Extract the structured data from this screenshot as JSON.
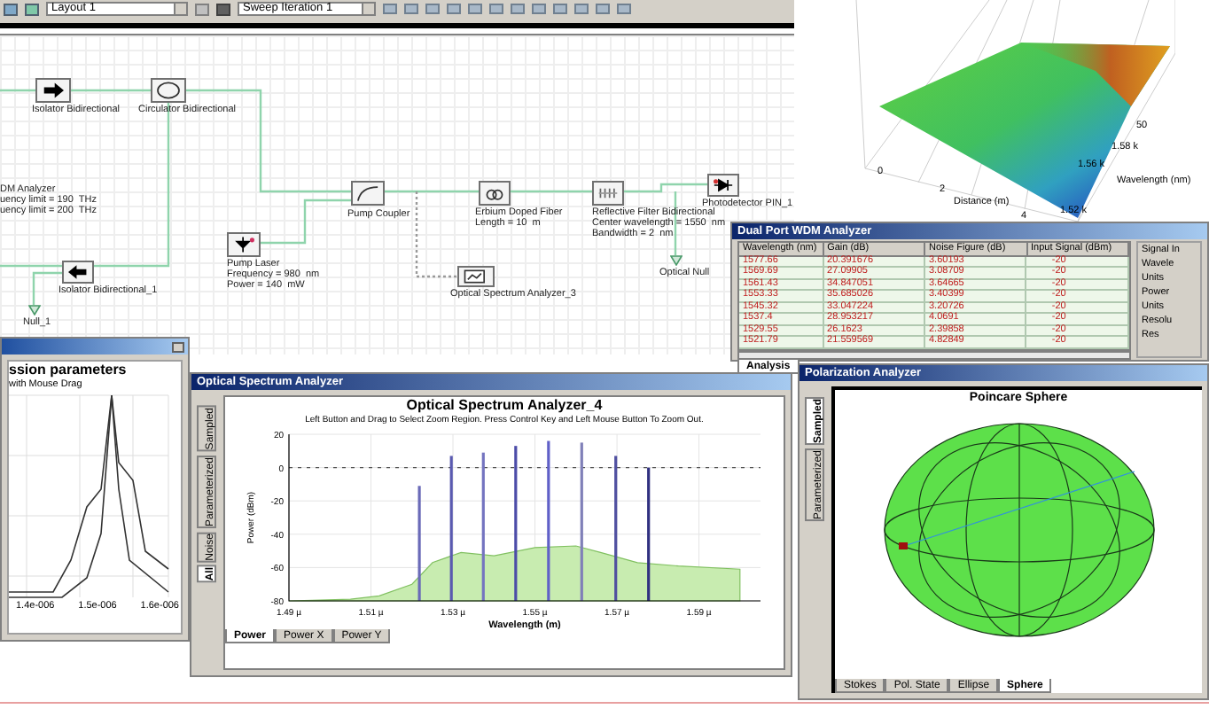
{
  "toolbar": {
    "layout_select": "Layout 1",
    "sweep_select": "Sweep Iteration 1"
  },
  "schematic": {
    "components": [
      {
        "kind": "isolator",
        "reversed": false,
        "label": [
          "Isolator Bidirectional"
        ]
      },
      {
        "kind": "circulator",
        "label": [
          "Circulator Bidirectional"
        ]
      },
      {
        "kind": "text",
        "label": [
          "DM Analyzer",
          "uency limit = 190  THz",
          "uency limit = 200  THz"
        ]
      },
      {
        "kind": "coupler",
        "label": [
          "Pump Coupler"
        ]
      },
      {
        "kind": "fiber",
        "label": [
          "Erbium Doped Fiber",
          "Length = 10  m"
        ]
      },
      {
        "kind": "filter",
        "label": [
          "Reflective Filter Bidirectional",
          "Center wavelength = 1550  nm",
          "Bandwidth = 2  nm"
        ]
      },
      {
        "kind": "photodetector",
        "label": [
          "Photodetector PIN_1"
        ]
      },
      {
        "kind": "laser",
        "label": [
          "Pump Laser",
          "Frequency = 980  nm",
          "Power = 140  mW"
        ]
      },
      {
        "kind": "isolator",
        "reversed": true,
        "label": [
          "Isolator Bidirectional_1"
        ]
      },
      {
        "kind": "analyzer",
        "label": [
          "Optical Spectrum Analyzer_3"
        ]
      },
      {
        "kind": "null",
        "label": [
          "Optical Null"
        ]
      },
      {
        "kind": "null",
        "label": [
          "Null_1"
        ]
      }
    ]
  },
  "surface_plot": {
    "wavelength_label": "Wavelength (nm)",
    "distance_label": "Distance (m)",
    "wavelength_ticks": [
      "1.58 k",
      "1.56 k",
      "1.52 k"
    ],
    "distance_ticks": [
      "0",
      "2",
      "4"
    ],
    "z_ticks": [
      "50"
    ]
  },
  "wdm_analyzer": {
    "title": "Dual Port WDM Analyzer",
    "columns": [
      "Wavelength (nm)",
      "Gain (dB)",
      "Noise Figure (dB)",
      "Input Signal (dBm)"
    ],
    "rows": [
      [
        "1577.66",
        "20.391676",
        "3.60193",
        "-20"
      ],
      [
        "1569.69",
        "27.09905",
        "3.08709",
        "-20"
      ],
      [
        "1561.43",
        "34.847051",
        "3.64665",
        "-20"
      ],
      [
        "1553.33",
        "35.685026",
        "3.40399",
        "-20"
      ],
      [
        "1545.32",
        "33.047224",
        "3.20726",
        "-20"
      ],
      [
        "1537.4",
        "28.953217",
        "4.0691",
        "-20"
      ],
      [
        "1529.55",
        "26.1623",
        "2.39858",
        "-20"
      ],
      [
        "1521.79",
        "21.559569",
        "4.82849",
        "-20"
      ]
    ],
    "side_labels": [
      "Signal In",
      "Wavele",
      "Units",
      "Power",
      "Units",
      "Resolu",
      "Res"
    ],
    "tabs": [
      {
        "label": "Analysis",
        "selected": true
      }
    ]
  },
  "transmission_window": {
    "title": "ssion parameters",
    "subtitle": "with Mouse Drag",
    "x_ticks": [
      "1.4e-006",
      "1.5e-006",
      "1.6e-006"
    ]
  },
  "spectrum_window": {
    "title": "Optical Spectrum Analyzer",
    "side_tabs": [
      {
        "label": "Sampled",
        "selected": false
      },
      {
        "label": "Parameterized",
        "selected": false
      },
      {
        "label": "Noise",
        "selected": false
      },
      {
        "label": "All",
        "selected": true
      }
    ],
    "subtitle": "Left Button and Drag to Select Zoom Region. Press Control Key and Left Mouse Button To Zoom Out.",
    "chart_data": {
      "type": "line",
      "title": "Optical Spectrum Analyzer_4",
      "xlabel": "Wavelength (m)",
      "ylabel": "Power (dBm)",
      "x": [
        1.5218,
        1.5218,
        1.5296,
        1.5296,
        1.5374,
        1.5374,
        1.5453,
        1.5453,
        1.5533,
        1.5533,
        1.5614,
        1.5614,
        1.5697,
        1.5697,
        1.5777,
        1.5777
      ],
      "series": [
        {
          "color": "#6a6ab8",
          "values": [
            -80,
            -11,
            null,
            null,
            null,
            null,
            null,
            null,
            null,
            null,
            null,
            null,
            null,
            null,
            null,
            null
          ]
        },
        {
          "color": "#5a5ab0",
          "values": [
            null,
            null,
            -80,
            7,
            null,
            null,
            null,
            null,
            null,
            null,
            null,
            null,
            null,
            null,
            null,
            null
          ]
        },
        {
          "color": "#7474c0",
          "values": [
            null,
            null,
            null,
            null,
            -80,
            9,
            null,
            null,
            null,
            null,
            null,
            null,
            null,
            null,
            null,
            null
          ]
        },
        {
          "color": "#4c4ca8",
          "values": [
            null,
            null,
            null,
            null,
            null,
            null,
            -80,
            13,
            null,
            null,
            null,
            null,
            null,
            null,
            null,
            null
          ]
        },
        {
          "color": "#6060c8",
          "values": [
            null,
            null,
            null,
            null,
            null,
            null,
            null,
            null,
            -80,
            16,
            null,
            null,
            null,
            null,
            null,
            null
          ]
        },
        {
          "color": "#8080b8",
          "values": [
            null,
            null,
            null,
            null,
            null,
            null,
            null,
            null,
            null,
            null,
            -80,
            15,
            null,
            null,
            null,
            null
          ]
        },
        {
          "color": "#5050a0",
          "values": [
            null,
            null,
            null,
            null,
            null,
            null,
            null,
            null,
            null,
            null,
            null,
            null,
            -80,
            7,
            null,
            null
          ]
        },
        {
          "color": "#303080",
          "values": [
            null,
            null,
            null,
            null,
            null,
            null,
            null,
            null,
            null,
            null,
            null,
            null,
            null,
            null,
            -80,
            0
          ]
        }
      ],
      "ref_lines": [
        {
          "axis": "y",
          "value": 0
        }
      ],
      "grid": true,
      "xlim": [
        1.49,
        1.605
      ],
      "ylim": [
        -80,
        20
      ],
      "xticks": [
        {
          "value": 1.49,
          "label": "1.49 µ"
        },
        {
          "value": 1.51,
          "label": "1.51 µ"
        },
        {
          "value": 1.53,
          "label": "1.53 µ"
        },
        {
          "value": 1.55,
          "label": "1.55 µ"
        },
        {
          "value": 1.57,
          "label": "1.57 µ"
        },
        {
          "value": 1.59,
          "label": "1.59 µ"
        }
      ],
      "yticks": [
        20,
        0,
        -20,
        -40,
        -60,
        -80
      ]
    },
    "tabs": [
      {
        "label": "Power",
        "selected": true
      },
      {
        "label": "Power X",
        "selected": false
      },
      {
        "label": "Power Y",
        "selected": false
      }
    ]
  },
  "polarization_window": {
    "title": "Polarization Analyzer",
    "side_tabs": [
      {
        "label": "Sampled",
        "selected": true
      },
      {
        "label": "Parameterized",
        "selected": false
      }
    ],
    "chart_title": "Poincare Sphere",
    "tabs": [
      {
        "label": "Stokes",
        "selected": false
      },
      {
        "label": "Pol. State",
        "selected": false
      },
      {
        "label": "Ellipse",
        "selected": false
      },
      {
        "label": "Sphere",
        "selected": true
      }
    ]
  }
}
